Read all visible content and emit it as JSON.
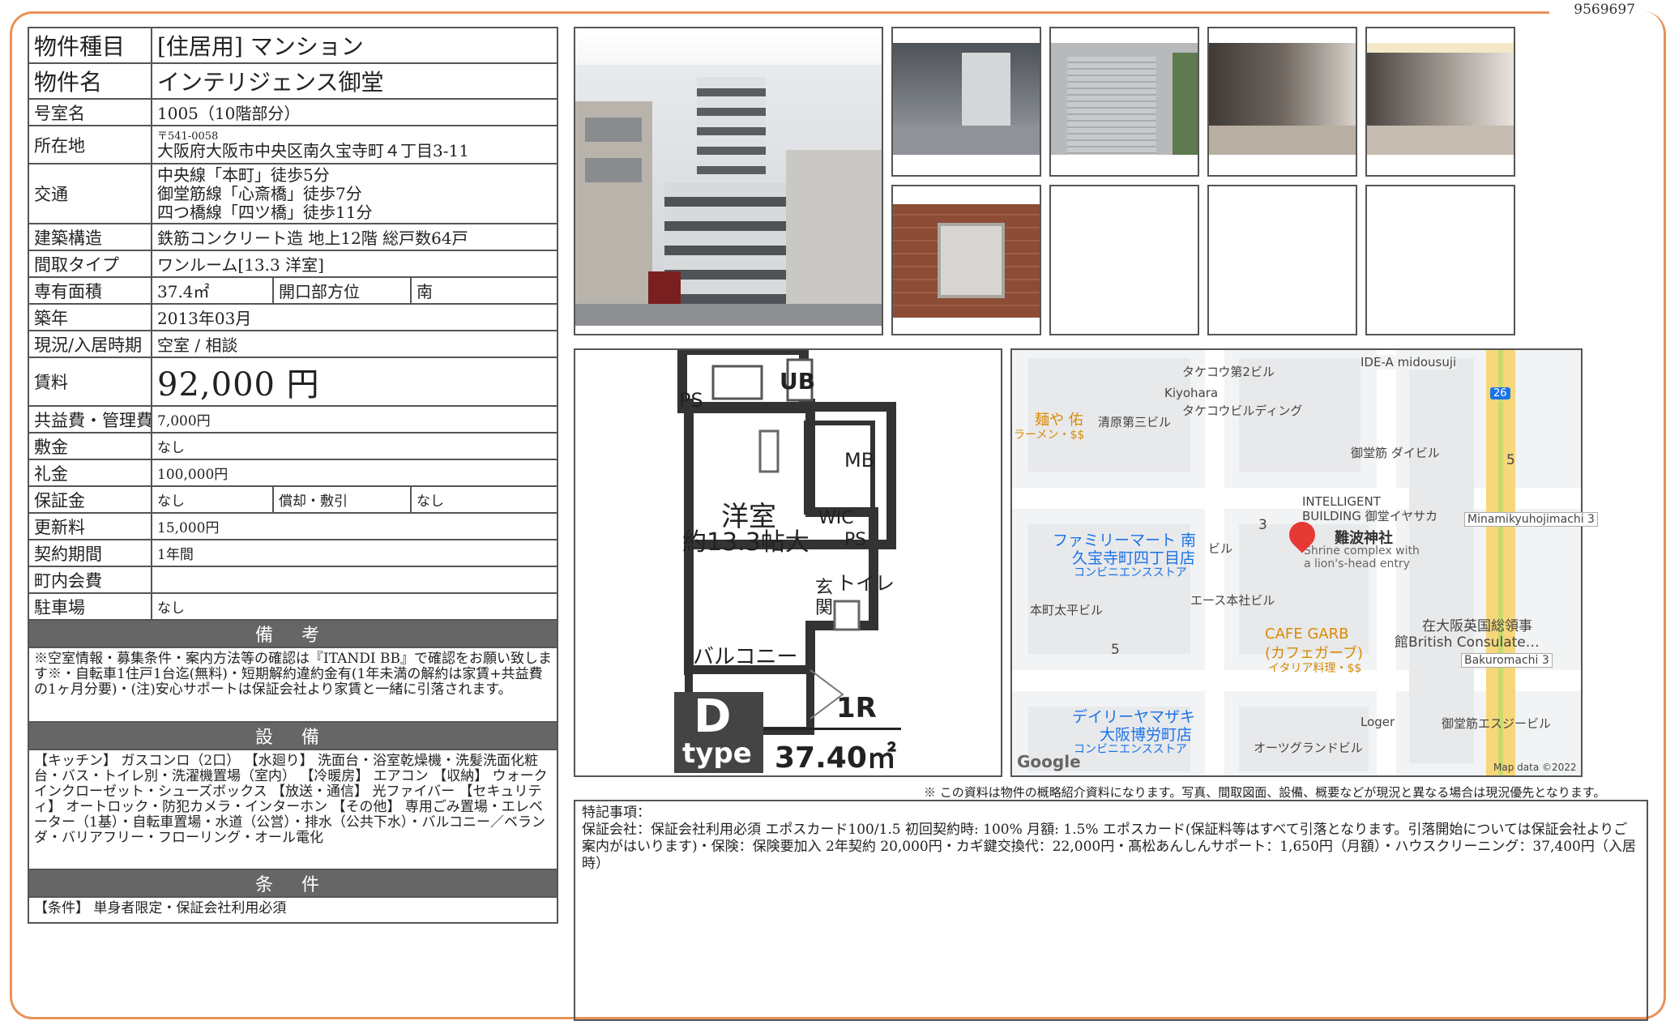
{
  "doc_number": "9569697",
  "spec": {
    "type_label": "物件種目",
    "type_value": "[住居用] マンション",
    "name_label": "物件名",
    "name_value": "インテリジェンス御堂",
    "room_label": "号室名",
    "room_value": "1005（10階部分）",
    "addr_label": "所在地",
    "addr_zip": "〒541-0058",
    "addr_value": "大阪府大阪市中央区南久宝寺町４丁目3-11",
    "traffic_label": "交通",
    "traffic_lines": [
      "中央線「本町」徒歩5分",
      "御堂筋線「心斎橋」徒歩7分",
      "四つ橋線「四ツ橋」徒歩11分"
    ],
    "structure_label": "建築構造",
    "structure_value": "鉄筋コンクリート造 地上12階 総戸数64戸",
    "layout_label": "間取タイプ",
    "layout_value": "ワンルーム[13.3 洋室]",
    "area_label": "専有面積",
    "area_value": "37.4㎡",
    "facing_label": "開口部方位",
    "facing_value": "南",
    "built_label": "築年",
    "built_value": "2013年03月",
    "status_label": "現況/入居時期",
    "status_value": "空室 /  相談",
    "rent_label": "賃料",
    "rent_value": "92,000 円",
    "fee_label": "共益費・管理費",
    "fee_value": "7,000円",
    "deposit_label": "敷金",
    "deposit_value": "なし",
    "key_label": "礼金",
    "key_value": "100,000円",
    "guarantee_label": "保証金",
    "guarantee_value": "なし",
    "amort_label": "償却・敷引",
    "amort_value": "なし",
    "renew_label": "更新料",
    "renew_value": "15,000円",
    "term_label": "契約期間",
    "term_value": "1年間",
    "town_label": "町内会費",
    "town_value": "",
    "parking_label": "駐車場",
    "parking_value": "なし"
  },
  "remarks": {
    "title": "備 考",
    "text": "※空室情報・募集条件・案内方法等の確認は『ITANDI BB』で確認をお願い致します※・自転車1住戸1台迄(無料)・短期解約違約金有(1年未満の解約は家賃+共益費の1ヶ月分要)・(注)安心サポートは保証会社より家賃と一緒に引落されます。"
  },
  "equipment": {
    "title": "設 備",
    "text": "【キッチン】 ガスコンロ（2口） 【水廻り】 洗面台・浴室乾燥機・洗髪洗面化粧台・バス・トイレ別・洗濯機置場（室内） 【冷暖房】 エアコン 【収納】 ウォークインクローゼット・シューズボックス 【放送・通信】 光ファイバー 【セキュリティ】 オートロック・防犯カメラ・インターホン 【その他】 専用ごみ置場・エレベーター（1基）・自転車置場・水道（公営）・排水（公共下水）・バルコニー／ベランダ・バリアフリー・フローリング・オール電化"
  },
  "conditions": {
    "title": "条 件",
    "text": "【条件】 単身者限定・保証会社利用必須"
  },
  "floorplan": {
    "room_label": "洋室",
    "room_size": "約13.3帖大",
    "ub": "UB",
    "mb": "MB",
    "wic": "WIC",
    "ps1": "PS",
    "ps2": "PS",
    "toilet": "トイレ",
    "entrance1": "玄",
    "entrance2": "関",
    "balcony": "バルコニー",
    "type_letter": "D",
    "type_word": "type",
    "layout": "1R",
    "area": "37.40㎡"
  },
  "map": {
    "labels": [
      "タケコウ第2ビル",
      "IDE-A midousuji",
      "Kiyohara",
      "麺や 佑",
      "ラーメン・$$",
      "清原第三ビル",
      "タケコウビルディング",
      "御堂筋 ダイビル",
      "INTELLIGENT",
      "BUILDING 御堂イヤサカ",
      "難波神社",
      "Shrine complex with",
      "a lion's-head entry",
      "Minamikyuhojimachi 3",
      "ファミリーマート 南",
      "久宝寺町四丁目店",
      "コンビニエンスストア",
      "ビル",
      "エース本社ビル",
      "本町太平ビル",
      "CAFE GARB",
      "(カフェガーブ)",
      "イタリア料理・$$",
      "在大阪英国総領事",
      "館British Consulate…",
      "Bakuromachi 3",
      "デイリーヤマザキ",
      "大阪博労町店",
      "コンビニエンスストア",
      "Loger",
      "御堂筋エスジービル",
      "オーツグランドビル"
    ],
    "numbers": [
      "3",
      "5",
      "5",
      "26"
    ],
    "google": "Google",
    "copyright": "Map data ©2022"
  },
  "caption": "※ この資料は物件の概略紹介資料になります。写真、間取図面、設備、概要などが現況と異なる場合は現況優先となります。",
  "notes": {
    "title": "特記事項：",
    "text": "保証会社：保証会社利用必須 エポスカード100/1.5 初回契約時: 100% 月額: 1.5% エポスカード(保証料等はすべて引落となります。引落開始については保証会社よりご案内がはいります)・保険：保険要加入 2年契約 20,000円・カギ鍵交換代：22,000円・髙松あんしんサポート：1,650円（月額）・ハウスクリーニング：37,400円（入居時）"
  }
}
